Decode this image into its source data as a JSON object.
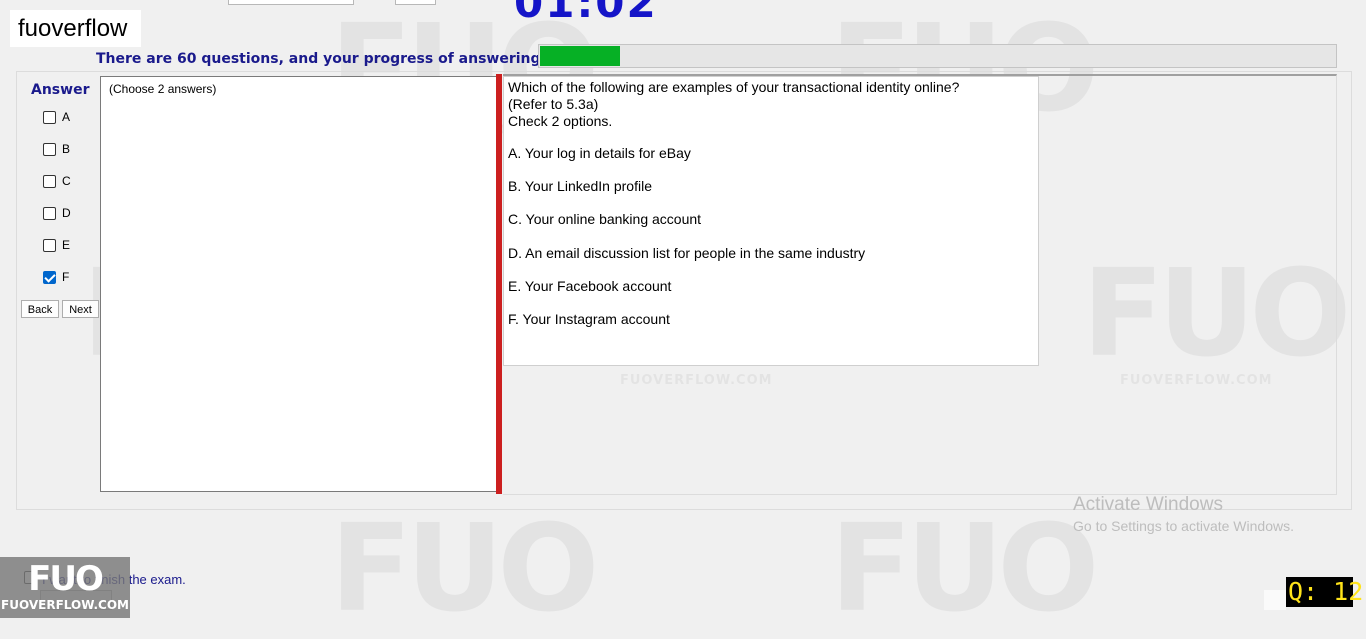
{
  "brand": "fuoverflow",
  "timer": "01:02",
  "progress": {
    "text": "There are 60 questions, and your progress of answering is",
    "fraction": 0.1
  },
  "answer_panel": {
    "label": "Answer",
    "options": [
      {
        "letter": "A",
        "checked": false
      },
      {
        "letter": "B",
        "checked": false
      },
      {
        "letter": "C",
        "checked": false
      },
      {
        "letter": "D",
        "checked": false
      },
      {
        "letter": "E",
        "checked": false
      },
      {
        "letter": "F",
        "checked": true
      }
    ],
    "back_label": "Back",
    "next_label": "Next"
  },
  "left_panel": {
    "hint": "(Choose 2 answers)"
  },
  "question": {
    "lines": [
      "Which of the following are examples of your transactional identity online?",
      "(Refer to 5.3a)",
      "Check 2 options."
    ],
    "options": [
      "A.  Your log in details for eBay",
      "B.  Your LinkedIn profile",
      "C.  Your online banking account",
      "D.  An email discussion list for people in the same industry",
      "E.  Your Facebook account",
      "F.  Your Instagram account"
    ]
  },
  "watermark": {
    "big": "FUO",
    "small": "FUOVERFLOW.COM"
  },
  "activation": {
    "title": "Activate Windows",
    "subtitle": "Go to Settings to activate Windows."
  },
  "finish": {
    "label": "I want to finish the exam."
  },
  "logo": {
    "big": "FUO",
    "small": "FUOVERFLOW.COM"
  },
  "question_counter": "Q: 12",
  "colors": {
    "progress_fill": "#06b025",
    "accent_blue": "#1a1a8c",
    "timer_blue": "#1515c8",
    "divider_red": "#cc1f1f",
    "counter_yellow": "#ffe31a"
  }
}
